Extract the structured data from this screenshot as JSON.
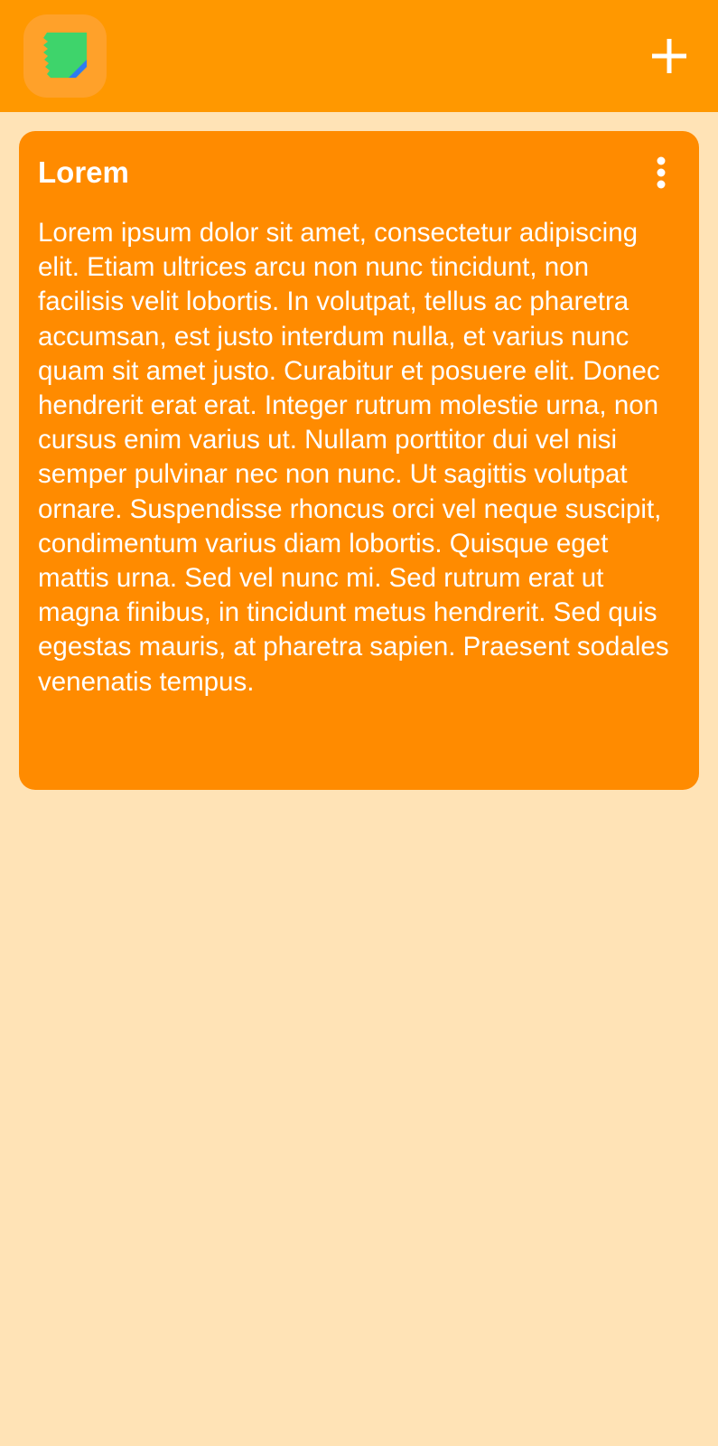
{
  "app_bar": {
    "logo_icon": "sticky-note-logo-icon",
    "add_icon": "plus-icon",
    "background": "#FF9800"
  },
  "notes": [
    {
      "title": "Lorem",
      "menu_icon": "more-vertical-icon",
      "body": "Lorem ipsum dolor sit amet, consectetur adipiscing elit. Etiam ultrices arcu non nunc tincidunt, non facilisis velit lobortis. In volutpat, tellus ac pharetra accumsan, est justo interdum nulla, et varius nunc quam sit amet justo. Curabitur et posuere elit. Donec hendrerit erat erat. Integer rutrum molestie urna, non cursus enim varius ut. Nullam porttitor dui vel nisi semper pulvinar nec non nunc. Ut sagittis volutpat ornare. Suspendisse rhoncus orci vel neque suscipit, condimentum varius diam lobortis. Quisque eget mattis urna. Sed vel nunc mi. Sed rutrum erat ut magna finibus, in tincidunt metus hendrerit. Sed quis egestas mauris, at pharetra sapien. Praesent sodales venenatis tempus.",
      "card_color": "#FF8B00"
    }
  ],
  "page_background": "#FFE3B6"
}
